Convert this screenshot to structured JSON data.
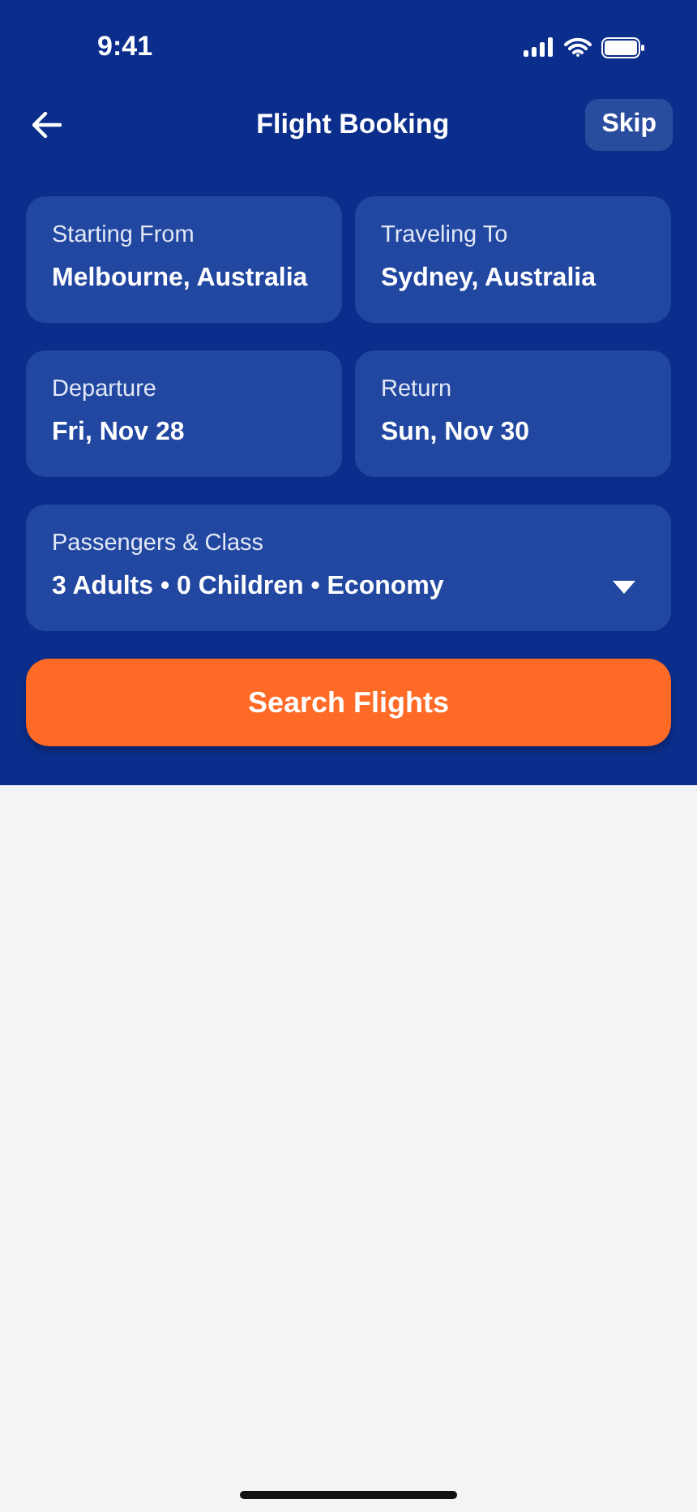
{
  "status_bar": {
    "time": "9:41"
  },
  "header": {
    "title": "Flight Booking",
    "skip": "Skip"
  },
  "fields": [
    {
      "label": "Starting From",
      "value": "Melbourne, Australia"
    },
    {
      "label": "Traveling To",
      "value": "Sydney, Australia"
    },
    {
      "label": "Departure",
      "value": "Fri, Nov 28"
    },
    {
      "label": "Return",
      "value": "Sun, Nov 30"
    }
  ],
  "passengers": {
    "label": "Passengers & Class",
    "value": "3 Adults • 0 Children • Economy"
  },
  "search_button": "Search Flights"
}
